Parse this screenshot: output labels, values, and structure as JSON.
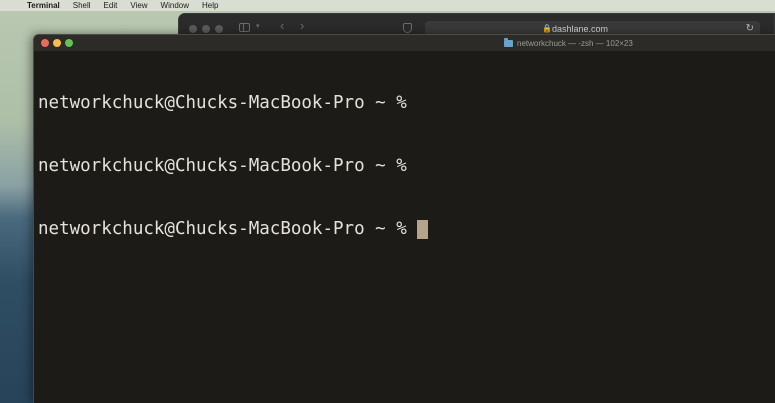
{
  "menubar": {
    "apple_glyph": "",
    "items": [
      "Terminal",
      "Shell",
      "Edit",
      "View",
      "Window",
      "Help"
    ]
  },
  "browser": {
    "url": "dashlane.com",
    "lock_glyph": "🔒",
    "reload_glyph": "↻"
  },
  "terminal": {
    "title": "networkchuck — -zsh — 102×23",
    "lines": [
      "networkchuck@Chucks-MacBook-Pro ~ %",
      "networkchuck@Chucks-MacBook-Pro ~ %",
      "networkchuck@Chucks-MacBook-Pro ~ %"
    ]
  },
  "colors": {
    "terminal_bg": "#1c1b17",
    "terminal_text": "#e4e2da",
    "cursor": "#b3a48a",
    "close": "#ec6a5e",
    "minimize": "#f4bf4f",
    "zoom": "#61c454"
  }
}
